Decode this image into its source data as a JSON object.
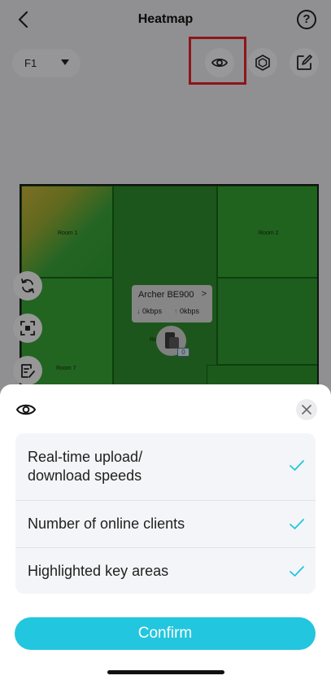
{
  "header": {
    "title": "Heatmap",
    "help_symbol": "?"
  },
  "toolbar": {
    "floor": "F1",
    "icons": [
      "eye-icon",
      "hexagon-icon",
      "edit-icon"
    ]
  },
  "map": {
    "rooms": [
      {
        "label": "Room 1"
      },
      {
        "label": "Room 2"
      },
      {
        "label": "Room 7"
      },
      {
        "label": "Ro"
      }
    ],
    "router": {
      "name": "Archer BE900",
      "chevron": ">",
      "download_arrow": "↓",
      "download": "0kbps",
      "upload_arrow": "↑",
      "upload": "0kbps",
      "clients": "0"
    }
  },
  "sheet": {
    "options": [
      {
        "label": "Real-time upload/ download speeds",
        "checked": true
      },
      {
        "label": "Number of online clients",
        "checked": true
      },
      {
        "label": "Highlighted key areas",
        "checked": true
      }
    ],
    "confirm_label": "Confirm"
  },
  "colors": {
    "accent": "#22c6de",
    "highlight": "#e4232b",
    "heat_green": "#2f9e2f",
    "heat_yellow": "#c9b33a"
  }
}
